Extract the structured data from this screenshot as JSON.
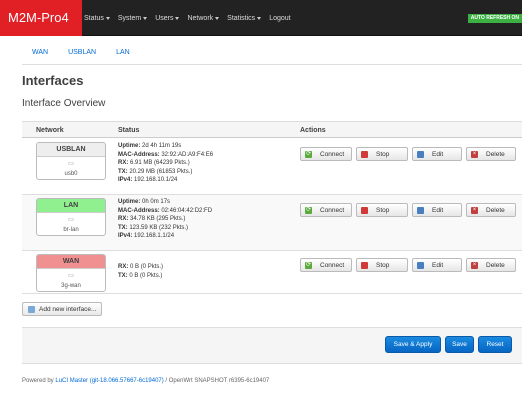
{
  "navbar": {
    "brand": "M2M-Pro4",
    "menu": [
      "Status",
      "System",
      "Users",
      "Network",
      "Statistics",
      "Logout"
    ],
    "auto_refresh": "AUTO REFRESH ON"
  },
  "tabs": [
    "WAN",
    "USBLAN",
    "LAN"
  ],
  "page_title": "Interfaces",
  "section_title": "Interface Overview",
  "table": {
    "headers": {
      "network": "Network",
      "status": "Status",
      "actions": "Actions"
    },
    "rows": [
      {
        "name": "USBLAN",
        "device": "usb0",
        "color": "#eeeeee",
        "status": [
          {
            "label": "Uptime:",
            "value": "2d 4h 11m 19s"
          },
          {
            "label": "MAC-Address:",
            "value": "32:92:AD:A9:F4:E6"
          },
          {
            "label": "RX:",
            "value": "6.91 MB (64239 Pkts.)"
          },
          {
            "label": "TX:",
            "value": "20.29 MB (61853 Pkts.)"
          },
          {
            "label": "IPv4:",
            "value": "192.168.10.1/24"
          }
        ]
      },
      {
        "name": "LAN",
        "device": "br-lan",
        "color": "#90f090",
        "status": [
          {
            "label": "Uptime:",
            "value": "0h 0m 17s"
          },
          {
            "label": "MAC-Address:",
            "value": "02:46:04:42:D2:FD"
          },
          {
            "label": "RX:",
            "value": "34.78 KB (295 Pkts.)"
          },
          {
            "label": "TX:",
            "value": "123.59 KB (232 Pkts.)"
          },
          {
            "label": "IPv4:",
            "value": "192.168.1.1/24"
          }
        ]
      },
      {
        "name": "WAN",
        "device": "3g-wan",
        "color": "#f09090",
        "status": [
          {
            "label": "RX:",
            "value": "0 B (0 Pkts.)"
          },
          {
            "label": "TX:",
            "value": "0 B (0 Pkts.)"
          }
        ]
      }
    ],
    "action_labels": {
      "connect": "Connect",
      "stop": "Stop",
      "edit": "Edit",
      "delete": "Delete"
    }
  },
  "add_interface_label": "Add new interface...",
  "footer_buttons": {
    "save_apply": "Save & Apply",
    "save": "Save",
    "reset": "Reset"
  },
  "powered_by": {
    "prefix": "Powered by ",
    "link": "LuCI Master (git-18.066.57667-6c19407)",
    "suffix": " / OpenWrt SNAPSHOT r6395-6c19407"
  },
  "colors": {
    "brand": "#e12026",
    "primary": "#0766c4",
    "link": "#0069d6"
  }
}
